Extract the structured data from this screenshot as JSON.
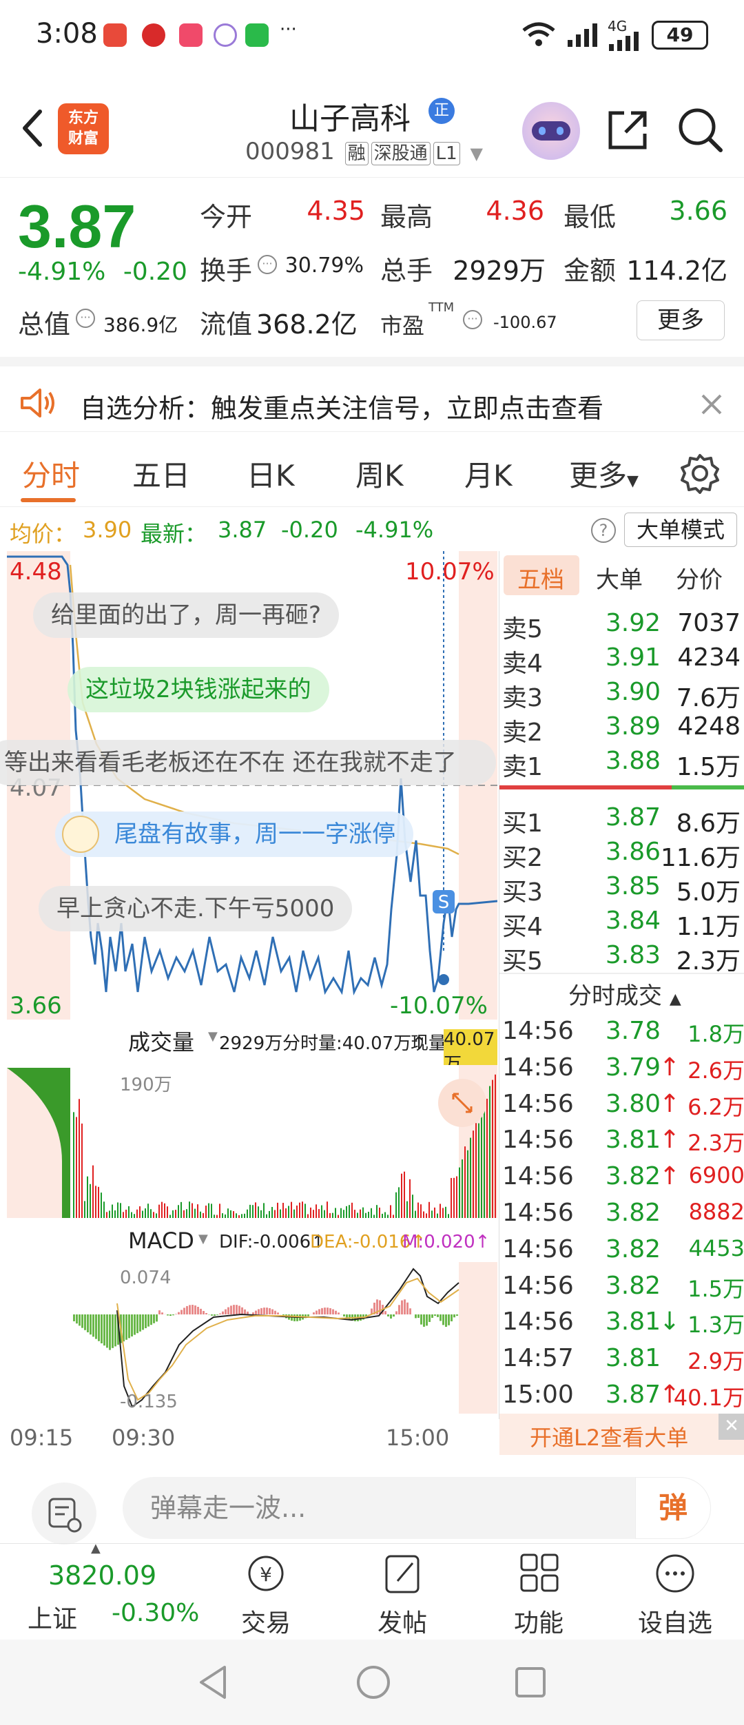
{
  "status_bar": {
    "time": "3:08",
    "signal_label": "4G",
    "battery": "49",
    "more": "···"
  },
  "header": {
    "logo_text_top": "东方",
    "logo_text_bottom": "财富",
    "stock_name": "山子高科",
    "badge": "正",
    "code": "000981",
    "tags": [
      "融",
      "深股通",
      "L1"
    ]
  },
  "quote": {
    "price": "3.87",
    "change_pct": "-4.91%",
    "change": "-0.20",
    "rows": [
      {
        "l1": "今开",
        "v1": "4.35",
        "l2": "最高",
        "v2": "4.36",
        "l3": "最低",
        "v3": "3.66"
      },
      {
        "l1": "换手",
        "v1": "30.79%",
        "l2": "总手",
        "v2": "2929万",
        "l3": "金额",
        "v3": "114.2亿"
      }
    ],
    "total_value_label": "总值",
    "total_value": "386.9亿",
    "float_value_label": "流值",
    "float_value": "368.2亿",
    "pe_label": "市盈",
    "pe_sup": "TTM",
    "pe_value": "-100.67",
    "more_button": "更多"
  },
  "alert": {
    "text": "自选分析：触发重点关注信号，立即点击查看"
  },
  "tabs": [
    "分时",
    "五日",
    "日K",
    "周K",
    "月K",
    "更多"
  ],
  "avg_line": {
    "avg_label": "均价：",
    "avg_value": "3.90",
    "latest_label": "最新：",
    "latest_value": "3.87",
    "latest_change": "-0.20",
    "latest_pct": "-4.91%",
    "big_order_mode": "大单模式"
  },
  "chart": {
    "high_price": "4.48",
    "high_pct": "10.07%",
    "mid_price": "4.07",
    "low_price": "3.66",
    "low_pct": "-10.07%",
    "s_marker": "S",
    "danmu": [
      "给里面的出了，周一再砸?",
      "这垃圾2块钱涨起来的",
      "等出来看看毛老板还在不在  还在我就不走了",
      "尾盘有故事，周一一字涨停",
      "早上贪心不走.下午亏5000"
    ],
    "volume_header": {
      "label": "成交量",
      "total": "2929万",
      "split": "分时量:40.07万↑",
      "now_label": "现量:",
      "now": "40.07万"
    },
    "volume_max": "190万",
    "macd_header": {
      "label": "MACD",
      "dif": "DIF:-0.006↑",
      "dea": "DEA:-0.016↑",
      "m": "M:0.020↑"
    },
    "macd_max": "0.074",
    "macd_min": "-0.135",
    "time_axis": [
      "09:15",
      "09:30",
      "15:00"
    ]
  },
  "order_book": {
    "tabs": [
      "五档",
      "大单",
      "分价"
    ],
    "asks": [
      {
        "label": "卖5",
        "price": "3.92",
        "vol": "7037"
      },
      {
        "label": "卖4",
        "price": "3.91",
        "vol": "4234"
      },
      {
        "label": "卖3",
        "price": "3.90",
        "vol": "7.6万"
      },
      {
        "label": "卖2",
        "price": "3.89",
        "vol": "4248"
      },
      {
        "label": "卖1",
        "price": "3.88",
        "vol": "1.5万"
      }
    ],
    "bids": [
      {
        "label": "买1",
        "price": "3.87",
        "vol": "8.6万"
      },
      {
        "label": "买2",
        "price": "3.86",
        "vol": "11.6万"
      },
      {
        "label": "买3",
        "price": "3.85",
        "vol": "5.0万"
      },
      {
        "label": "买4",
        "price": "3.84",
        "vol": "1.1万"
      },
      {
        "label": "买5",
        "price": "3.83",
        "vol": "2.3万"
      }
    ],
    "trades_header": "分时成交",
    "trades": [
      {
        "time": "14:56",
        "price": "3.78",
        "arrow": "",
        "vol": "1.8万",
        "color": "#1a9a2a"
      },
      {
        "time": "14:56",
        "price": "3.79",
        "arrow": "↑",
        "vol": "2.6万",
        "color": "#e02020"
      },
      {
        "time": "14:56",
        "price": "3.80",
        "arrow": "↑",
        "vol": "6.2万",
        "color": "#e02020"
      },
      {
        "time": "14:56",
        "price": "3.81",
        "arrow": "↑",
        "vol": "2.3万",
        "color": "#e02020"
      },
      {
        "time": "14:56",
        "price": "3.82",
        "arrow": "↑",
        "vol": "6900",
        "color": "#e02020"
      },
      {
        "time": "14:56",
        "price": "3.82",
        "arrow": "",
        "vol": "8882",
        "color": "#e02020"
      },
      {
        "time": "14:56",
        "price": "3.82",
        "arrow": "",
        "vol": "4453",
        "color": "#1a9a2a"
      },
      {
        "time": "14:56",
        "price": "3.82",
        "arrow": "",
        "vol": "1.5万",
        "color": "#1a9a2a"
      },
      {
        "time": "14:56",
        "price": "3.81",
        "arrow": "↓",
        "vol": "1.3万",
        "color": "#1a9a2a"
      },
      {
        "time": "14:57",
        "price": "3.81",
        "arrow": "",
        "vol": "2.9万",
        "color": "#e02020"
      },
      {
        "time": "15:00",
        "price": "3.87",
        "arrow": "↑",
        "vol": "40.1万",
        "color": "#e02020"
      }
    ],
    "l2_promo": "开通L2查看大单"
  },
  "danmu_input": {
    "placeholder": "弹幕走一波...",
    "button": "弹"
  },
  "bottom_nav": {
    "index_value": "3820.09",
    "index_name": "上证",
    "index_change": "-0.30%",
    "items": [
      "交易",
      "发帖",
      "功能",
      "设自选"
    ]
  },
  "colors": {
    "up": "#e02020",
    "down": "#1a9a2a",
    "accent": "#e8702a",
    "price_line": "#2f6fb5",
    "avg_line": "#e0b04a"
  }
}
